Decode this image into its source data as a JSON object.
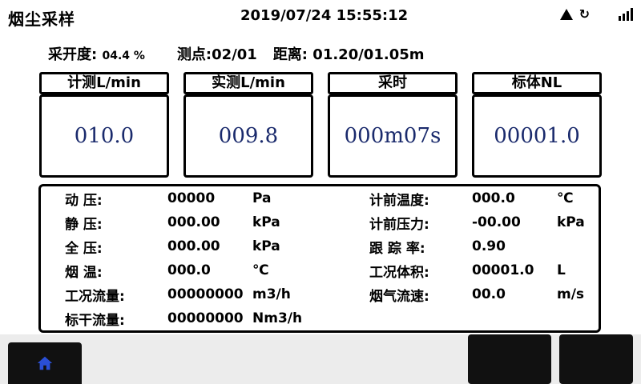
{
  "header": {
    "title": "烟尘采样",
    "datetime": "2019/07/24 15:55:12"
  },
  "info": {
    "sampling_rate_label": "采开度:",
    "sampling_rate_value": "04.4 %",
    "measure_point_label": "测点:",
    "measure_point_value": "02/01",
    "distance_label": "距离:",
    "distance_value": "01.20/01.05m"
  },
  "cards": [
    {
      "label": "计测L/min",
      "value": "010.0"
    },
    {
      "label": "实测L/min",
      "value": "009.8"
    },
    {
      "label": "采时",
      "value": "000m07s"
    },
    {
      "label": "标体NL",
      "value": "00001.0"
    }
  ],
  "details": {
    "left": [
      {
        "label": "动    压:",
        "value": "00000",
        "unit": "Pa"
      },
      {
        "label": "静    压:",
        "value": "000.00",
        "unit": "kPa"
      },
      {
        "label": "全    压:",
        "value": "000.00",
        "unit": "kPa"
      },
      {
        "label": "烟    温:",
        "value": "000.0",
        "unit": "℃"
      },
      {
        "label": "工况流量:",
        "value": "00000000",
        "unit": "m3/h"
      },
      {
        "label": "标干流量:",
        "value": "00000000",
        "unit": "Nm3/h"
      }
    ],
    "right": [
      {
        "label": "计前温度:",
        "value": "000.0",
        "unit": "℃"
      },
      {
        "label": "计前压力:",
        "value": "-00.00",
        "unit": "kPa"
      },
      {
        "label": "跟 踪 率:",
        "value": "0.90",
        "unit": ""
      },
      {
        "label": "工况体积:",
        "value": "00001.0",
        "unit": "L"
      },
      {
        "label": "烟气流速:",
        "value": "00.0",
        "unit": "m/s"
      }
    ]
  },
  "icons": {
    "warning": "warning-icon",
    "refresh": "refresh-icon",
    "signal": "signal-icon",
    "home": "home-icon"
  },
  "colors": {
    "value_text": "#1a2a6c",
    "home_icon": "#2a4fd6"
  }
}
